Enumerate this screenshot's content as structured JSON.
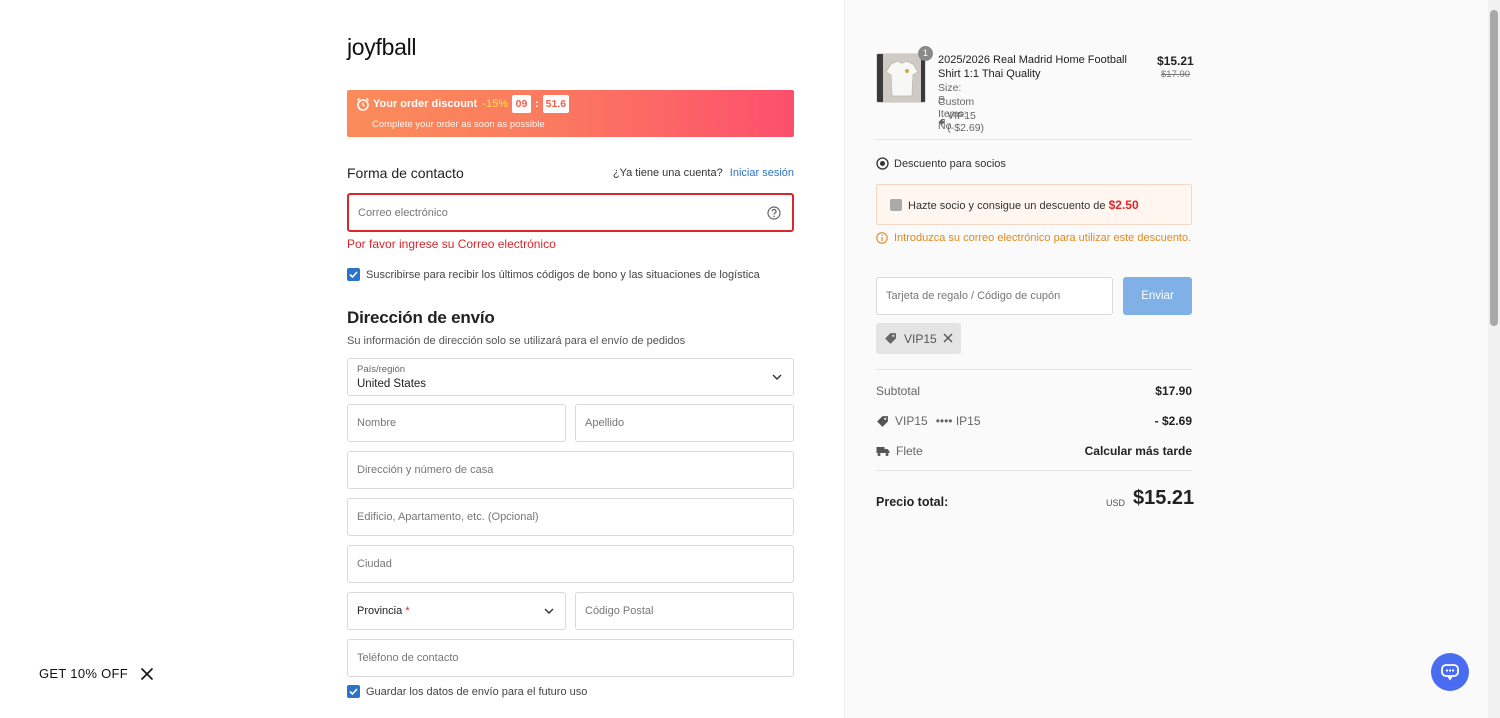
{
  "brand": {
    "logo": "joyfball"
  },
  "discount_banner": {
    "label": "Your order discount",
    "percent": "-15%",
    "timer_minutes": "09",
    "timer_seconds": "51.6",
    "subtitle": "Complete your order as soon as possible"
  },
  "contact": {
    "title": "Forma de contacto",
    "account_question": "¿Ya tiene una cuenta?",
    "login_link": "Iniciar sesión",
    "email_placeholder": "Correo electrónico",
    "email_error": "Por favor ingrese su Correo electrónico",
    "subscribe_label": "Suscribirse para recibir los últimos códigos de bono y las situaciones de logística",
    "subscribe_checked": true
  },
  "shipping": {
    "title": "Dirección de envío",
    "subtitle": "Su información de dirección solo se utilizará para el envío de pedidos",
    "country_label": "País/región",
    "country_value": "United States",
    "first_name_placeholder": "Nombre",
    "last_name_placeholder": "Apellido",
    "address_placeholder": "Dirección y número de casa",
    "address2_placeholder": "Edificio, Apartamento, etc. (Opcional)",
    "city_placeholder": "Ciudad",
    "province_label": "Provincia",
    "province_required": "*",
    "postal_placeholder": "Código Postal",
    "phone_placeholder": "Teléfono de contacto",
    "save_label": "Guardar los datos de envío para el futuro uso",
    "save_checked": true
  },
  "cart": {
    "item": {
      "quantity": "1",
      "name": "2025/2026 Real Madrid Home Football Shirt 1:1 Thai Quality",
      "size": "Size: S",
      "custom": "Custom Items: No",
      "coupon": "VIP15 (-$2.69)",
      "price": "$15.21",
      "old_price": "$17.90"
    },
    "member": {
      "title": "Descuento para socios",
      "offer_text": "Hazte socio y consigue un descuento de",
      "offer_amount": "$2.50",
      "info": "Introduzca su correo electrónico para utilizar este descuento."
    },
    "coupon": {
      "placeholder": "Tarjeta de regalo / Código de cupón",
      "send_label": "Enviar",
      "applied_code": "VIP15"
    },
    "summary": {
      "subtotal_label": "Subtotal",
      "subtotal_value": "$17.90",
      "discount_label": "VIP15",
      "discount_masked": "•••• IP15",
      "discount_value": "- $2.69",
      "shipping_label": "Flete",
      "shipping_value": "Calcular más tarde",
      "total_label": "Precio total:",
      "total_currency": "USD",
      "total_value": "$15.21"
    }
  },
  "promo": {
    "label": "GET 10% OFF"
  },
  "colors": {
    "accent": "#2b74c7",
    "error": "#d9262b",
    "chat": "#4a6cf0"
  }
}
